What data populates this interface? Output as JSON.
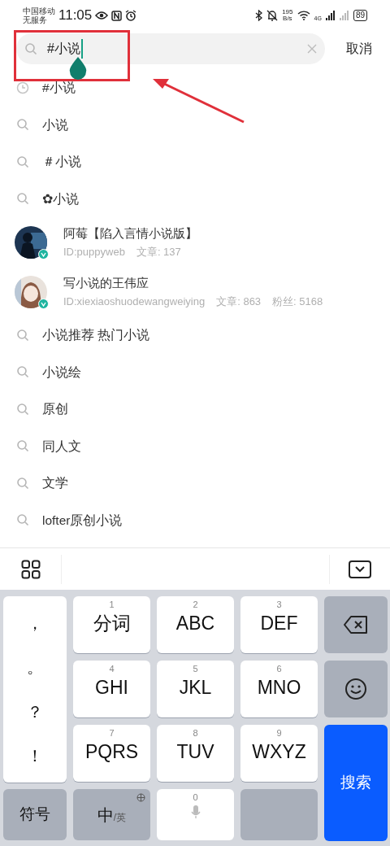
{
  "status_bar": {
    "carrier": "中国移动",
    "service": "无服务",
    "time": "11:05",
    "speed_value": "195",
    "speed_unit": "B/s",
    "network": "4G",
    "battery": "89"
  },
  "search": {
    "value": "#小说",
    "cancel": "取消"
  },
  "results": [
    {
      "kind": "history",
      "text": "#小说"
    },
    {
      "kind": "query",
      "text": "小说"
    },
    {
      "kind": "query",
      "text": "＃小说"
    },
    {
      "kind": "query",
      "text": "✿小说"
    },
    {
      "kind": "user",
      "name": "阿莓【陷入言情小说版】",
      "id": "ID:puppyweb",
      "stats": [
        "文章: 137"
      ],
      "verified": true
    },
    {
      "kind": "user",
      "name": "写小说的王伟应",
      "id": "ID:xiexiaoshuodewangweiying",
      "stats": [
        "文章: 863",
        "粉丝: 5168"
      ],
      "verified": true
    },
    {
      "kind": "query",
      "text": "小说推荐 热门小说"
    },
    {
      "kind": "query",
      "text": "小说绘"
    },
    {
      "kind": "query",
      "text": "原创"
    },
    {
      "kind": "query",
      "text": "同人文"
    },
    {
      "kind": "query",
      "text": "文学"
    },
    {
      "kind": "query",
      "text": "lofter原创小说"
    }
  ],
  "keyboard": {
    "punctuation": [
      "，",
      "。",
      "？",
      "！"
    ],
    "keys": [
      {
        "digit": "1",
        "label": "分词"
      },
      {
        "digit": "2",
        "label": "ABC"
      },
      {
        "digit": "3",
        "label": "DEF"
      },
      {
        "digit": "4",
        "label": "GHI"
      },
      {
        "digit": "5",
        "label": "JKL"
      },
      {
        "digit": "6",
        "label": "MNO"
      },
      {
        "digit": "7",
        "label": "PQRS"
      },
      {
        "digit": "8",
        "label": "TUV"
      },
      {
        "digit": "9",
        "label": "WXYZ"
      }
    ],
    "search_key": "搜索",
    "symbols_key": "符号",
    "lang_main": "中",
    "lang_alt": "/英",
    "space_digit": "0"
  }
}
